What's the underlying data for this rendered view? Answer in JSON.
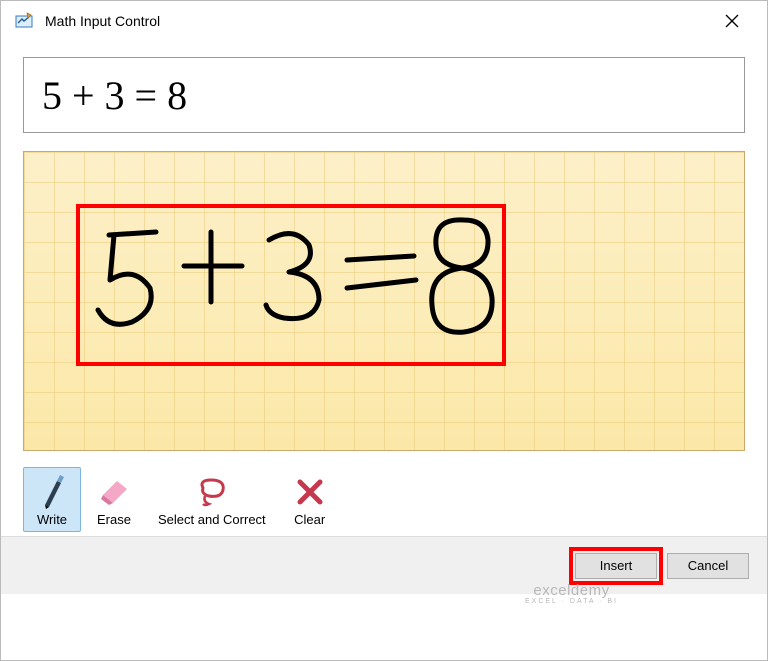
{
  "title": "Math Input Control",
  "preview_equation": "5 + 3 = 8",
  "handwritten_equation": "5+3=8",
  "toolbar": {
    "write": "Write",
    "erase": "Erase",
    "select_correct": "Select and Correct",
    "clear": "Clear"
  },
  "buttons": {
    "insert": "Insert",
    "cancel": "Cancel"
  },
  "watermark": {
    "main": "exceldemy",
    "sub": "EXCEL · DATA · BI"
  }
}
